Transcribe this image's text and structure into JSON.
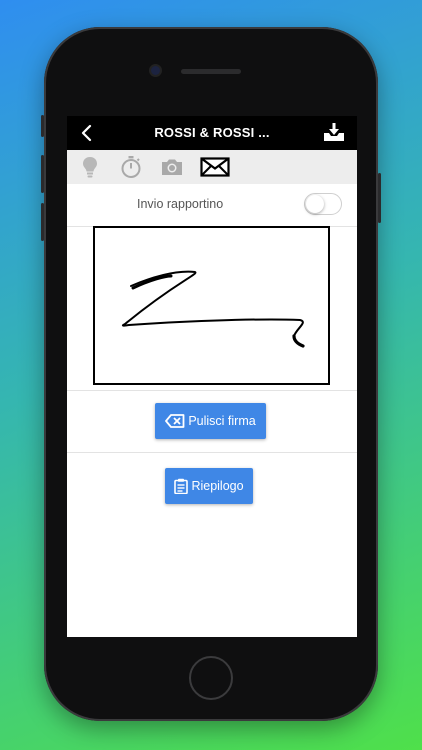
{
  "header": {
    "title": "ROSSI & ROSSI ...",
    "back_icon": "chevron-left-icon",
    "download_icon": "download-tray-icon"
  },
  "toolbar": {
    "icons": [
      "lightbulb-icon",
      "stopwatch-icon",
      "camera-icon",
      "envelope-icon"
    ],
    "active": "envelope-icon"
  },
  "settings": {
    "send_report_label": "Invio rapportino",
    "send_report_enabled": false
  },
  "buttons": {
    "clear_signature": "Pulisci firma",
    "summary": "Riepilogo"
  },
  "colors": {
    "primary_button": "#3f87e6",
    "header_bg": "#000000",
    "toolbar_bg": "#ededed"
  }
}
